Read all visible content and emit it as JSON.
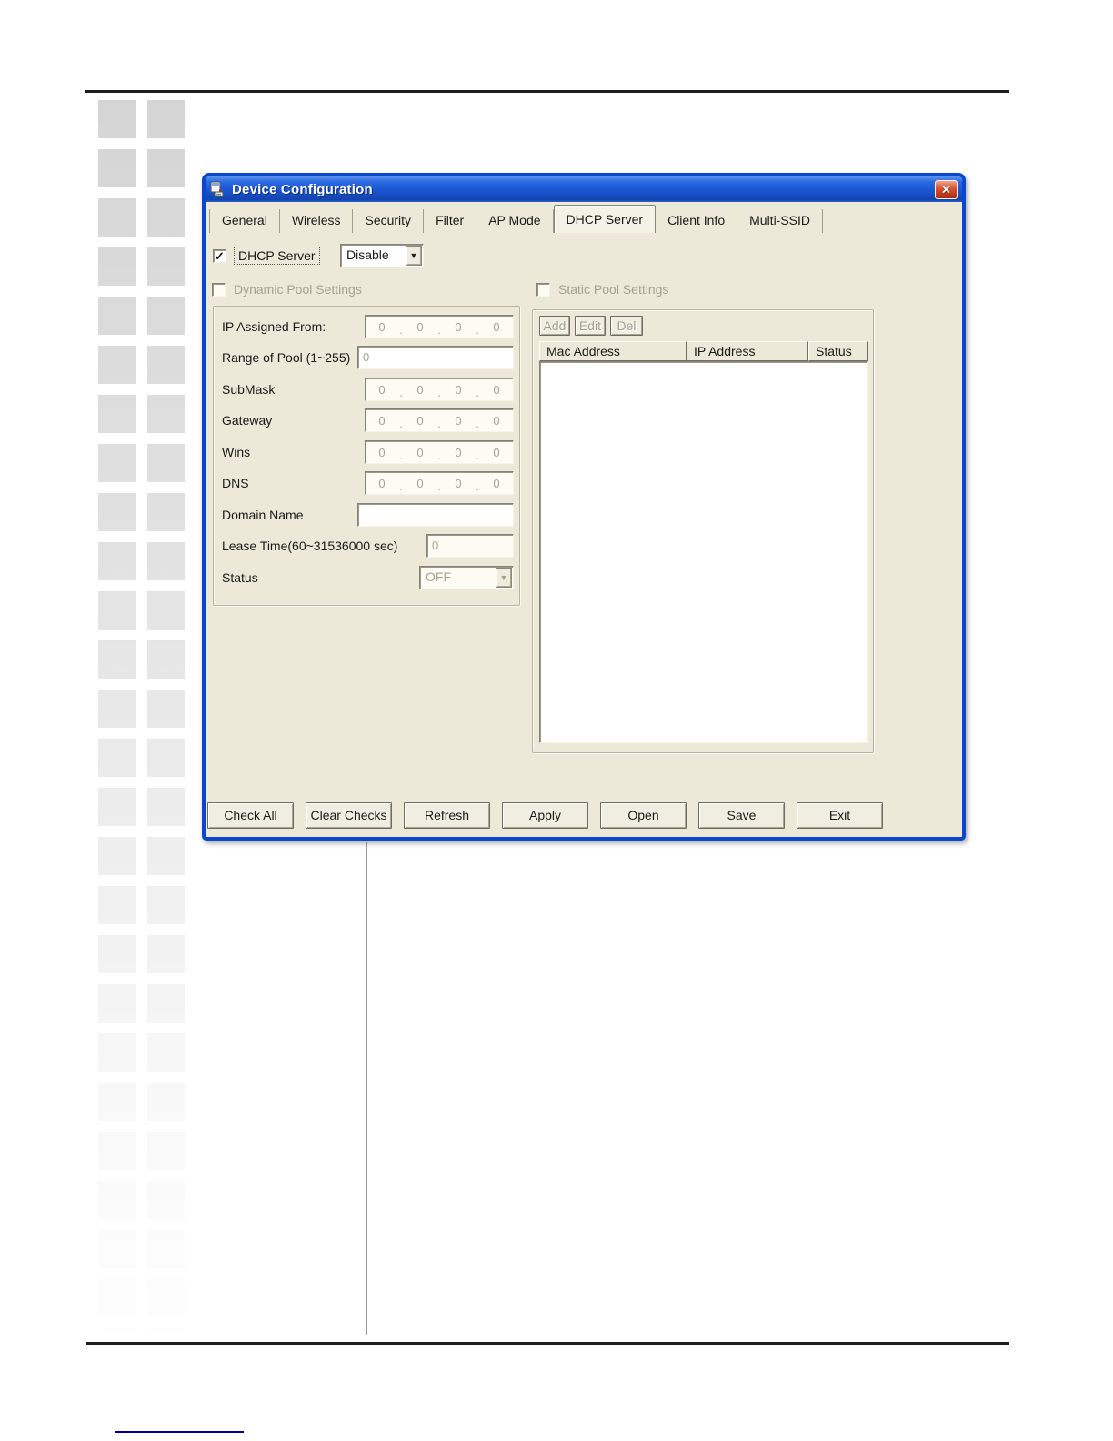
{
  "window": {
    "title": "Device Configuration"
  },
  "tabs": [
    {
      "label": "General",
      "active": false
    },
    {
      "label": "Wireless",
      "active": false
    },
    {
      "label": "Security",
      "active": false
    },
    {
      "label": "Filter",
      "active": false
    },
    {
      "label": "AP Mode",
      "active": false
    },
    {
      "label": "DHCP Server",
      "active": true
    },
    {
      "label": "Client Info",
      "active": false
    },
    {
      "label": "Multi-SSID",
      "active": false
    }
  ],
  "dhcp": {
    "checkbox_label": "DHCP Server",
    "checked": true,
    "mode_value": "Disable"
  },
  "dynamic_pool": {
    "label": "Dynamic Pool Settings",
    "checked": false,
    "fields": [
      {
        "label": "IP Assigned From:",
        "octets": [
          "0",
          "0",
          "0",
          "0"
        ]
      },
      {
        "label": "Range of Pool (1~255)",
        "value": "0"
      },
      {
        "label": "SubMask",
        "octets": [
          "0",
          "0",
          "0",
          "0"
        ]
      },
      {
        "label": "Gateway",
        "octets": [
          "0",
          "0",
          "0",
          "0"
        ]
      },
      {
        "label": "Wins",
        "octets": [
          "0",
          "0",
          "0",
          "0"
        ]
      },
      {
        "label": "DNS",
        "octets": [
          "0",
          "0",
          "0",
          "0"
        ]
      },
      {
        "label": "Domain Name",
        "value": ""
      },
      {
        "label": "Lease Time(60~31536000 sec)",
        "value": "0"
      },
      {
        "label": "Status",
        "value": "OFF"
      }
    ]
  },
  "static_pool": {
    "label": "Static Pool Settings",
    "checked": false,
    "buttons": [
      "Add",
      "Edit",
      "Del"
    ],
    "table": {
      "headers": [
        "Mac Address",
        "IP Address",
        "Status"
      ],
      "rows": []
    }
  },
  "footer": {
    "buttons": [
      "Check All",
      "Clear Checks",
      "Refresh",
      "Apply",
      "Open",
      "Save",
      "Exit"
    ]
  },
  "icons": {
    "close": "✕",
    "dropdown_arrow": "▼",
    "check": "✓"
  },
  "colors": {
    "titlebar_blue_top": "#5b93ee",
    "titlebar_blue_bottom": "#1345ae",
    "window_border": "#0a46d0",
    "dialog_bg": "#ece9d8",
    "close_red": "#cc4526",
    "disabled_text": "#a5a294",
    "rule_dark": "#1d1d1d",
    "footer_link_blue": "#00009b",
    "deco_gray": "#d4d4d4"
  }
}
